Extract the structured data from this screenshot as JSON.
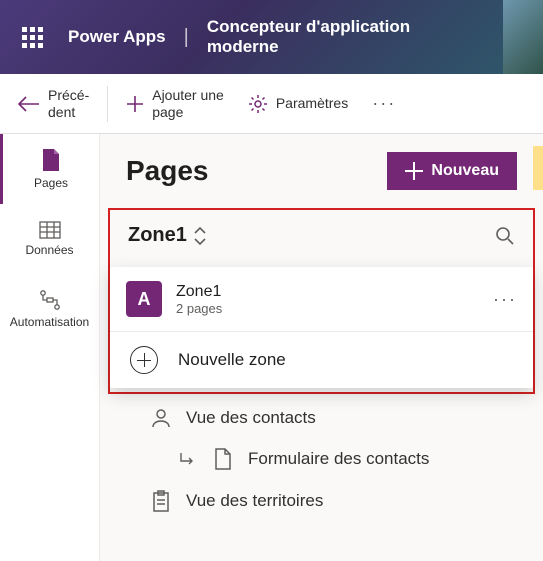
{
  "header": {
    "app_name": "Power Apps",
    "subtitle": "Concepteur d'application moderne"
  },
  "toolbar": {
    "back_label": "Précé-\ndent",
    "add_page_label": "Ajouter une\npage",
    "settings_label": "Paramètres"
  },
  "leftnav": {
    "items": [
      {
        "label": "Pages"
      },
      {
        "label": "Données"
      },
      {
        "label": "Automatisation"
      }
    ]
  },
  "main": {
    "title": "Pages",
    "new_button": "Nouveau",
    "zone_header": "Zone1",
    "popup": {
      "zone_badge": "A",
      "zone_name": "Zone1",
      "zone_sub": "2 pages",
      "new_zone_label": "Nouvelle zone"
    },
    "tree": [
      {
        "label": "Vue des contacts",
        "icon": "person",
        "sub": false
      },
      {
        "label": "Formulaire des contacts",
        "icon": "form",
        "sub": true
      },
      {
        "label": "Vue des territoires",
        "icon": "clipboard",
        "sub": false
      }
    ]
  }
}
